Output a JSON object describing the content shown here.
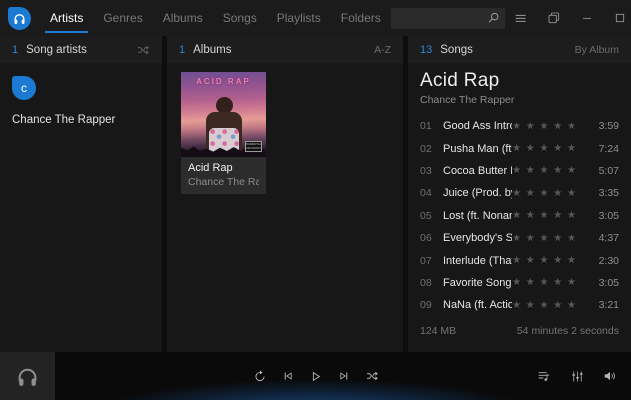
{
  "colors": {
    "accent": "#2e86d6",
    "tab_underline": "#1e7ad4",
    "logo_blue": "#1d7ad2",
    "player_glow": "#2676cc"
  },
  "titlebar": {
    "tabs": [
      {
        "label": "Artists",
        "active": true
      },
      {
        "label": "Genres",
        "active": false
      },
      {
        "label": "Albums",
        "active": false
      },
      {
        "label": "Songs",
        "active": false
      },
      {
        "label": "Playlists",
        "active": false
      },
      {
        "label": "Folders",
        "active": false
      }
    ],
    "search": {
      "value": "",
      "placeholder": ""
    }
  },
  "artists_panel": {
    "count": "1",
    "title": "Song artists",
    "artist": {
      "initial": "c",
      "name": "Chance The Rapper"
    }
  },
  "albums_panel": {
    "count": "1",
    "title": "Albums",
    "sort": "A-Z",
    "album": {
      "title": "Acid Rap",
      "artist": "Chance The Rapper",
      "cover_text": "ACID RAP",
      "advisory": "PARENTAL ADVISORY"
    }
  },
  "songs_panel": {
    "count": "13",
    "title": "Songs",
    "sort": "By Album",
    "album_title": "Acid Rap",
    "album_artist": "Chance The Rapper",
    "rating_glyphs": "★ ★ ★ ★ ★",
    "tracks": [
      {
        "no": "01",
        "title": "Good Ass Intro (ft. BJ...",
        "rating": 5,
        "duration": "3:59"
      },
      {
        "no": "02",
        "title": "Pusha Man (ft. Nate F...",
        "rating": 5,
        "duration": "7:24"
      },
      {
        "no": "03",
        "title": "Cocoa Butter Kisses (ft...",
        "rating": 5,
        "duration": "5:07"
      },
      {
        "no": "04",
        "title": "Juice (Prod. by Nate F...",
        "rating": 5,
        "duration": "3:35"
      },
      {
        "no": "05",
        "title": "Lost (ft. Noname Gyps...",
        "rating": 5,
        "duration": "3:05"
      },
      {
        "no": "06",
        "title": "Everybody's Somethin...",
        "rating": 5,
        "duration": "4:37"
      },
      {
        "no": "07",
        "title": "Interlude (That's Love)...",
        "rating": 5,
        "duration": "2:30"
      },
      {
        "no": "08",
        "title": "Favorite Song (ft. Child...",
        "rating": 5,
        "duration": "3:05"
      },
      {
        "no": "09",
        "title": "NaNa (ft. Action Brons...",
        "rating": 5,
        "duration": "3:21"
      }
    ],
    "footer": {
      "size": "124 MB",
      "total_duration": "54 minutes 2 seconds"
    }
  },
  "icons": {
    "app_logo": "headphones-in-blue-drop",
    "search": "magnifier",
    "menu": "hamburger-lines",
    "stacked_windows": "overlapping-squares",
    "minimize": "–",
    "maximize": "□",
    "close": "✕",
    "shuffle": "crossed-arrows",
    "loop": "circular-arrow",
    "previous": "bar-left-triangle",
    "play": "outline-triangle",
    "next": "right-triangle-bar",
    "queue": "list-with-note",
    "equalizer": "vertical-sliders",
    "volume": "speaker-waves"
  }
}
